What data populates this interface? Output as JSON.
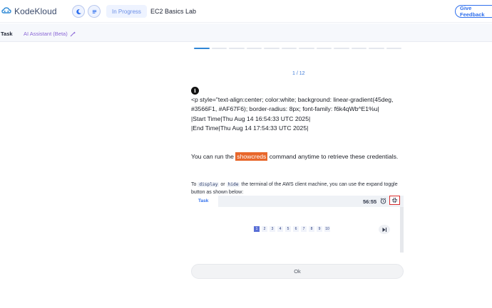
{
  "app": {
    "brand": "KodeKloud"
  },
  "header": {
    "status": "In Progress",
    "lab_title": "EC2 Basics Lab",
    "feedback_label": "Give Feedback"
  },
  "tabs": {
    "task": "Task",
    "ai_assistant": "AI Assistant (Beta)"
  },
  "progress": {
    "total_steps": 12,
    "current_step": 1,
    "page_label": "1 / 12"
  },
  "content": {
    "raw_html_lines": [
      "<p style=\"text-align:center; color:white; background: linear-gradient(45deg,",
      "#3566F1, #AF67F6); border-radius: 8px; font-family: f6k4qWb^E1%u|",
      "|Start Time|Thu Aug 14 16:54:33 UTC 2025|",
      "|End Time|Thu Aug 14 17:54:33 UTC 2025|"
    ],
    "creds_before": "You can run the ",
    "creds_command": "showcreds",
    "creds_after": " command anytime to retrieve these credentials.",
    "toggle_text_1": "To ",
    "toggle_code_1": "display",
    "toggle_text_2": " or ",
    "toggle_code_2": "hide",
    "toggle_text_3": " the terminal of the AWS client machine, you can use the expand toggle button as shown below:"
  },
  "preview": {
    "tab_label": "Task",
    "timer": "56:55",
    "pages": [
      "1",
      "2",
      "3",
      "4",
      "5",
      "6",
      "7",
      "8",
      "9",
      "10"
    ]
  },
  "footer": {
    "ok_label": "Ok"
  },
  "colors": {
    "accent": "#2f6fed",
    "highlight": "#e8672b",
    "ai": "#8a66d6"
  }
}
